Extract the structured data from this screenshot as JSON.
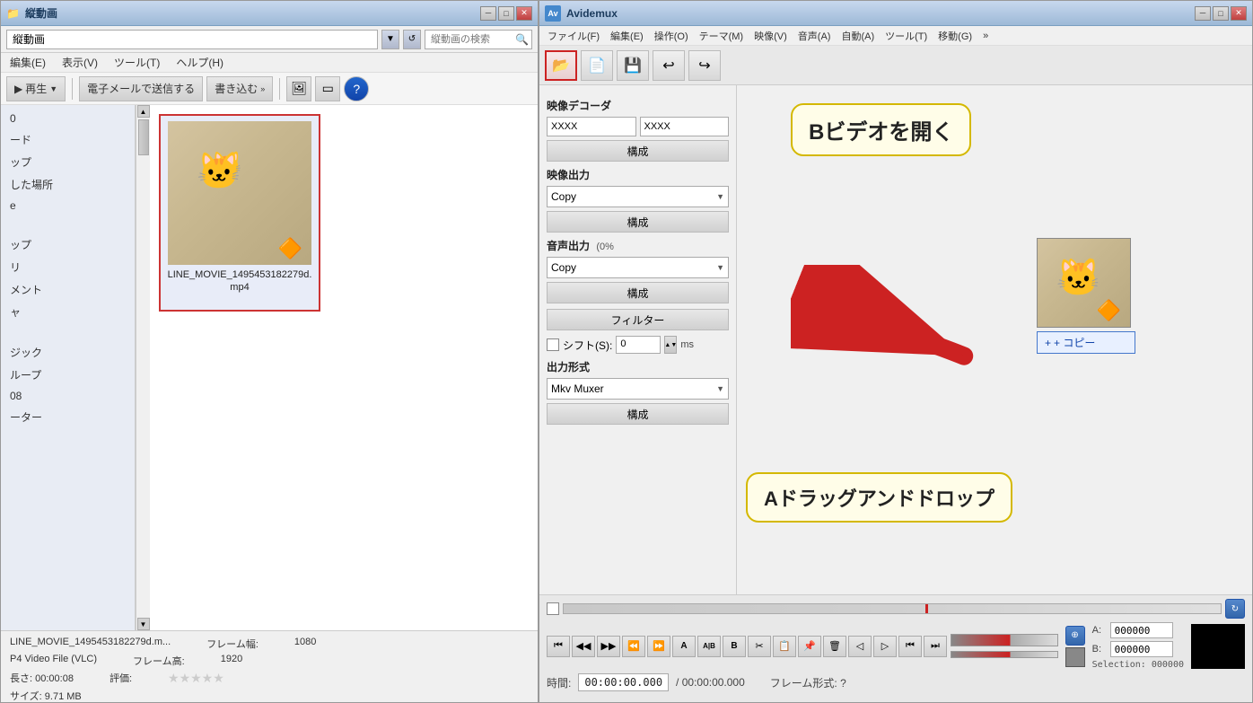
{
  "explorer": {
    "title": "縦動画",
    "search_placeholder": "縦動画の検索",
    "menu": [
      "編集(E)",
      "表示(V)",
      "ツール(T)",
      "ヘルプ(H)"
    ],
    "toolbar": {
      "play_label": "再生",
      "email_label": "電子メールで送信する",
      "burn_label": "書き込む"
    },
    "sidebar_items": [
      "0",
      "ード",
      "ップ",
      "した場所",
      "e",
      "ップ",
      "リ",
      "メント",
      "ャ",
      "ジック",
      "ループ",
      "08",
      "ーター"
    ],
    "file": {
      "name": "LINE_MOVIE_1495453182279d.mp4"
    },
    "status": {
      "filename": "LINE_MOVIE_1495453182279d.m...",
      "type": "P4 Video File (VLC)",
      "duration_label": "長さ:",
      "duration_value": "00:00:08",
      "size_label": "サイズ:",
      "size_value": "9.71 MB",
      "width_label": "フレーム幅:",
      "width_value": "1080",
      "height_label": "フレーム高:",
      "height_value": "1920",
      "rating_label": "評価:"
    }
  },
  "avidemux": {
    "title": "Avidemux",
    "app_icon": "Av",
    "menu": [
      "ファイル(F)",
      "編集(E)",
      "操作(O)",
      "テーマ(M)",
      "映像(V)",
      "音声(A)",
      "自動(A)",
      "ツール(T)",
      "移動(G)"
    ],
    "toolbar": {
      "open_btn": "📂"
    },
    "video_decoder": {
      "label": "映像デコーダ",
      "value": "XXXX",
      "config_btn": "構成"
    },
    "video_output": {
      "label": "映像出力",
      "copy_value": "Copy",
      "config_btn": "構成"
    },
    "audio_output": {
      "label": "音声出力",
      "percent": "(0%",
      "copy_value": "Copy",
      "config_btn": "構成",
      "filter_btn": "フィルター"
    },
    "shift": {
      "label": "シフト(S):",
      "value": "0",
      "unit": "ms"
    },
    "output_format": {
      "label": "出力形式",
      "value": "Mkv Muxer",
      "config_btn": "構成"
    },
    "callout_open": "Bビデオを開く",
    "callout_dnd": "Aドラッグアンドドロップ",
    "copy_button_label": "+ コピー",
    "bottom": {
      "time_label": "時間:",
      "time_value": "00:00:00.000",
      "total_time": "/ 00:00:00.000",
      "frame_format": "フレーム形式: ?",
      "selection_label": "Selection:",
      "selection_value": "000000",
      "a_label": "A:",
      "a_value": "000000",
      "b_label": "B:",
      "b_value": "000000"
    }
  }
}
